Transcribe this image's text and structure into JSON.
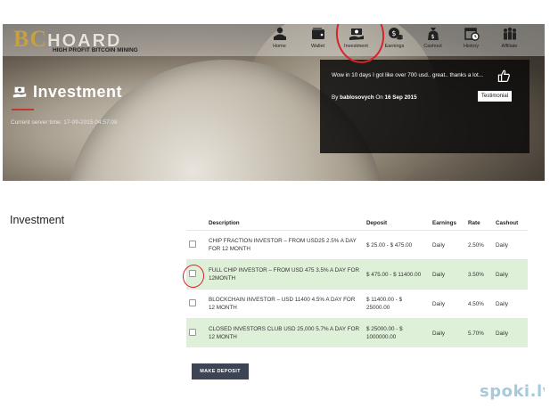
{
  "logo": {
    "brand_prefix": "BC",
    "brand_suffix": "HOARD",
    "tagline": "HIGH PROFIT BITCOIN MINING"
  },
  "nav": {
    "items": [
      {
        "label": "Home",
        "icon": "user-at-computer-icon"
      },
      {
        "label": "Wallet",
        "icon": "wallet-icon"
      },
      {
        "label": "Investment",
        "icon": "money-hand-icon"
      },
      {
        "label": "Earnings",
        "icon": "dollar-coins-icon"
      },
      {
        "label": "Cashout",
        "icon": "money-bag-icon"
      },
      {
        "label": "History",
        "icon": "calendar-clock-icon"
      },
      {
        "label": "Affiliate",
        "icon": "people-group-icon"
      }
    ]
  },
  "page": {
    "title": "Investment",
    "server_time": "Current server time: 17-09-2015 04:57:08"
  },
  "testimonial": {
    "quote": "Wow in 10 days I got like over 700 usd.. great.. thanks a lot...",
    "by_prefix": "By",
    "author": "bablosovych",
    "date_prefix": "On",
    "date": "16 Sep 2015",
    "button_label": "Testimonial"
  },
  "section_title": "Investment",
  "table": {
    "headers": [
      "Description",
      "Deposit",
      "Earnings",
      "Rate",
      "Cashout"
    ],
    "rows": [
      {
        "description": "CHIP FRACTION INVESTOR – FROM USD25 2.5% A DAY FOR 12 MONTH",
        "deposit": "$ 25.00 - $ 475.00",
        "earnings": "Daily",
        "rate": "2.50%",
        "cashout": "Daily"
      },
      {
        "description": "FULL CHIP INVESTOR – FROM USD 475 3.5% A DAY FOR 12MONTH",
        "deposit": "$ 475.00 - $ 11400.00",
        "earnings": "Daily",
        "rate": "3.50%",
        "cashout": "Daily"
      },
      {
        "description": "BLOCKCHAIN INVESTOR – USD 11400 4.5% A DAY FOR 12 MONTH",
        "deposit": "$ 11400.00 - $ 25000.00",
        "earnings": "Daily",
        "rate": "4.50%",
        "cashout": "Daily"
      },
      {
        "description": "CLOSED INVESTORS CLUB USD 25,000 5.7% A DAY FOR 12 MONTH",
        "deposit": "$ 25000.00 - $ 1000000.00",
        "earnings": "Daily",
        "rate": "5.70%",
        "cashout": "Daily"
      }
    ]
  },
  "make_deposit_label": "MAKE DEPOSIT",
  "watermark": "spoki.lv",
  "colors": {
    "logo_gold": "#c7a040",
    "annotation_red": "#d8232a",
    "row_highlight": "#dff0d8",
    "button_bg": "#3d4555",
    "underline_red": "#c0392b"
  }
}
